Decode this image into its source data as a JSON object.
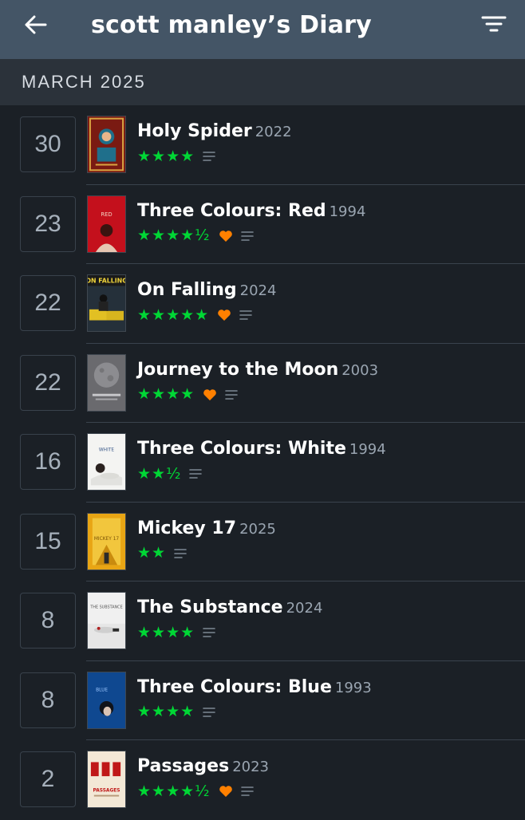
{
  "header": {
    "title": "scott manley’s Diary"
  },
  "section": {
    "label": "MARCH 2025"
  },
  "colors": {
    "header_bg": "#445566",
    "section_bg": "#2b323a",
    "page_bg": "#1b2026",
    "star_green": "#00d735",
    "heart_orange": "#ff8000",
    "year_gray": "#9aa5b1"
  },
  "entries": [
    {
      "day": "30",
      "title": "Holy Spider",
      "year": "2022",
      "stars": "★★★★",
      "rating": 4,
      "liked": false,
      "poster": "holy-spider-poster"
    },
    {
      "day": "23",
      "title": "Three Colours: Red",
      "year": "1994",
      "stars": "★★★★½",
      "rating": 4.5,
      "liked": true,
      "poster": "three-colours-red-poster",
      "poster_text": "RED"
    },
    {
      "day": "22",
      "title": "On Falling",
      "year": "2024",
      "stars": "★★★★★",
      "rating": 5,
      "liked": true,
      "poster": "on-falling-poster",
      "poster_text": "ON FALLING"
    },
    {
      "day": "22",
      "title": "Journey to the Moon",
      "year": "2003",
      "stars": "★★★★",
      "rating": 4,
      "liked": true,
      "poster": "journey-to-the-moon-poster",
      "poster_text": "Journey to the moon"
    },
    {
      "day": "16",
      "title": "Three Colours: White",
      "year": "1994",
      "stars": "★★½",
      "rating": 2.5,
      "liked": false,
      "poster": "three-colours-white-poster",
      "poster_text": "WHITE"
    },
    {
      "day": "15",
      "title": "Mickey 17",
      "year": "2025",
      "stars": "★★",
      "rating": 2,
      "liked": false,
      "poster": "mickey-17-poster",
      "poster_text": "MICKEY 17"
    },
    {
      "day": "8",
      "title": "The Substance",
      "year": "2024",
      "stars": "★★★★",
      "rating": 4,
      "liked": false,
      "poster": "the-substance-poster",
      "poster_text": "THE SUBSTANCE"
    },
    {
      "day": "8",
      "title": "Three Colours: Blue",
      "year": "1993",
      "stars": "★★★★",
      "rating": 4,
      "liked": false,
      "poster": "three-colours-blue-poster",
      "poster_text": "BLUE"
    },
    {
      "day": "2",
      "title": "Passages",
      "year": "2023",
      "stars": "★★★★½",
      "rating": 4.5,
      "liked": true,
      "poster": "passages-poster",
      "poster_text": "PASSAGES"
    }
  ]
}
